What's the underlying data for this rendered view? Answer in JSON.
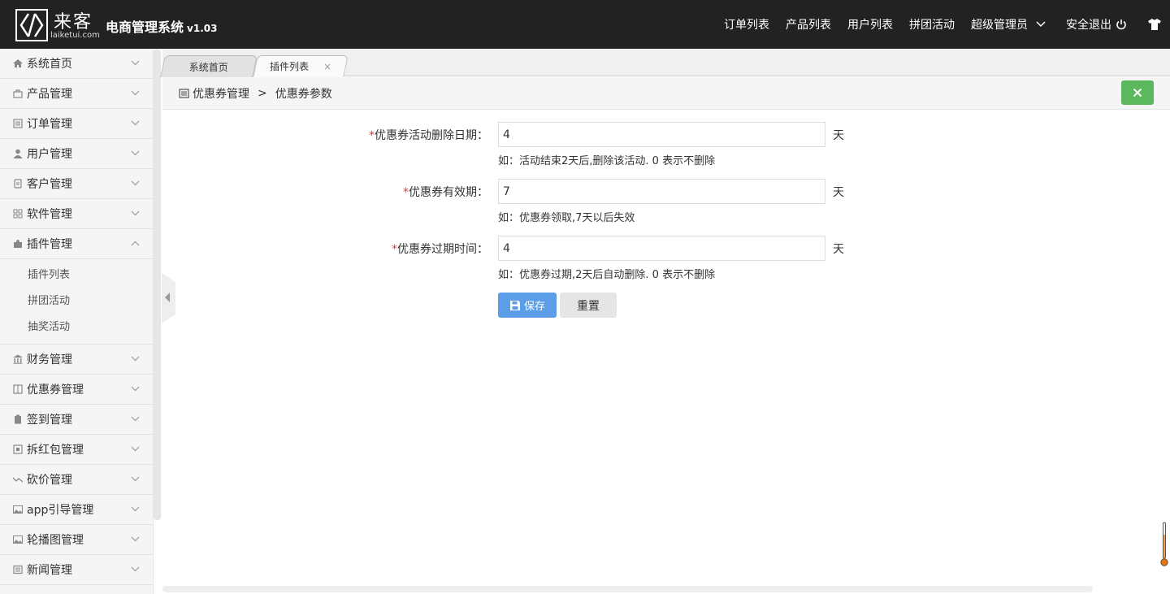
{
  "header": {
    "logo_cn": "来客",
    "logo_en": "laiketui.com",
    "title": "电商管理系统",
    "version": "v1.03",
    "nav": [
      {
        "label": "订单列表"
      },
      {
        "label": "产品列表"
      },
      {
        "label": "用户列表"
      },
      {
        "label": "拼团活动"
      },
      {
        "label": "超级管理员"
      },
      {
        "label": "安全退出"
      }
    ]
  },
  "sidebar": {
    "items": [
      {
        "label": "系统首页",
        "icon": "home-icon"
      },
      {
        "label": "产品管理",
        "icon": "bag-icon"
      },
      {
        "label": "订单管理",
        "icon": "list-icon"
      },
      {
        "label": "用户管理",
        "icon": "user-icon"
      },
      {
        "label": "客户管理",
        "icon": "doc-icon"
      },
      {
        "label": "软件管理",
        "icon": "grid-icon"
      },
      {
        "label": "插件管理",
        "icon": "puzzle-icon",
        "expanded": true,
        "children": [
          {
            "label": "插件列表"
          },
          {
            "label": "拼团活动"
          },
          {
            "label": "抽奖活动"
          }
        ]
      },
      {
        "label": "财务管理",
        "icon": "bank-icon"
      },
      {
        "label": "优惠券管理",
        "icon": "book-icon"
      },
      {
        "label": "签到管理",
        "icon": "clipboard-icon"
      },
      {
        "label": "拆红包管理",
        "icon": "envelope-icon"
      },
      {
        "label": "砍价管理",
        "icon": "trend-icon"
      },
      {
        "label": "app引导管理",
        "icon": "image-icon"
      },
      {
        "label": "轮播图管理",
        "icon": "image-icon"
      },
      {
        "label": "新闻管理",
        "icon": "news-icon"
      }
    ]
  },
  "tabs": [
    {
      "label": "系统首页"
    },
    {
      "label": "插件列表",
      "close": "×"
    }
  ],
  "breadcrumb": {
    "parent": "优惠券管理",
    "sep": ">",
    "current": "优惠券参数"
  },
  "form": {
    "rows": [
      {
        "required": "*",
        "label": "优惠券活动删除日期：",
        "value": "4",
        "unit": "天",
        "hint": "如：活动结束2天后,删除该活动. 0 表示不删除"
      },
      {
        "required": "*",
        "label": "优惠券有效期：",
        "value": "7",
        "unit": "天",
        "hint": "如：优惠券领取,7天以后失效"
      },
      {
        "required": "*",
        "label": "优惠券过期时间：",
        "value": "4",
        "unit": "天",
        "hint": "如：优惠券过期,2天后自动删除. 0 表示不删除"
      }
    ],
    "save_label": "保存",
    "reset_label": "重置"
  },
  "colors": {
    "header_bg": "#222222",
    "save_btn": "#5b9ee7",
    "close_btn": "#5cb85c",
    "required": "#e4393c"
  }
}
